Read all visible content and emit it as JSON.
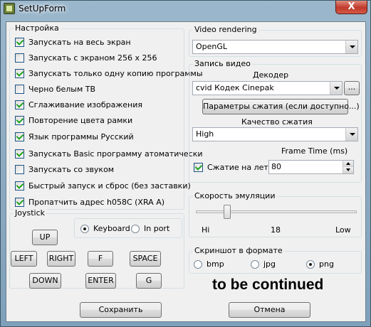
{
  "window": {
    "title": "SetUpForm",
    "close_glyph": "X"
  },
  "settings": {
    "title": "Настройка",
    "items": [
      {
        "label": "Запускать на весь экран",
        "checked": true
      },
      {
        "label": "Запускать с экраном 256 x 256",
        "checked": false
      },
      {
        "label": "Запускать только одну копию программы",
        "checked": true
      },
      {
        "label": "Черно белым ТВ",
        "checked": false
      },
      {
        "label": "Сглаживание изображения",
        "checked": true
      },
      {
        "label": "Повторение цвета рамки",
        "checked": true
      },
      {
        "label": "Язык программы Русский",
        "checked": true
      },
      {
        "label": "Запускать Basic программу атоматически",
        "checked": true
      },
      {
        "label": "Запускать со звуком",
        "checked": false
      },
      {
        "label": "Быстрый запуск и сброс (без заставки)",
        "checked": true
      },
      {
        "label": "Пропатчить адрес h058C (XRA A)",
        "checked": true
      }
    ]
  },
  "joystick": {
    "title": "Joystick",
    "keyboard_label": "Keyboard",
    "inport_label": "In port",
    "selected": "Keyboard",
    "buttons": {
      "up": "UP",
      "left": "LEFT",
      "right": "RIGHT",
      "f": "F",
      "space": "SPACE",
      "down": "DOWN",
      "enter": "ENTER",
      "g": "G"
    }
  },
  "video": {
    "title": "Video rendering",
    "selected": "OpenGL"
  },
  "record": {
    "title": "Запись видео",
    "decoder_label": "Декодер",
    "decoder_value": "cvid Кодек Cinepak",
    "browse_label": "...",
    "params_button": "Параметры сжатия (если доступно...)",
    "quality_label": "Качество сжатия",
    "quality_value": "High",
    "frame_time_label": "Frame Time (ms)",
    "compress_label": "Сжатие на лету",
    "compress_checked": true,
    "frame_time_value": "80"
  },
  "speed": {
    "title": "Скорость эмуляции",
    "hi": "Hi",
    "mid": "18",
    "low": "Low",
    "value": 18
  },
  "screenshot": {
    "title": "Скриншот в формате",
    "bmp": "bmp",
    "jpg": "jpg",
    "png": "png",
    "selected": "png"
  },
  "note": "to be continued",
  "footer": {
    "save": "Сохранить",
    "cancel": "Отмена"
  },
  "colors": {
    "accent": "#21a121",
    "close": "#c0392b",
    "titlebar": "#8fadc4"
  }
}
